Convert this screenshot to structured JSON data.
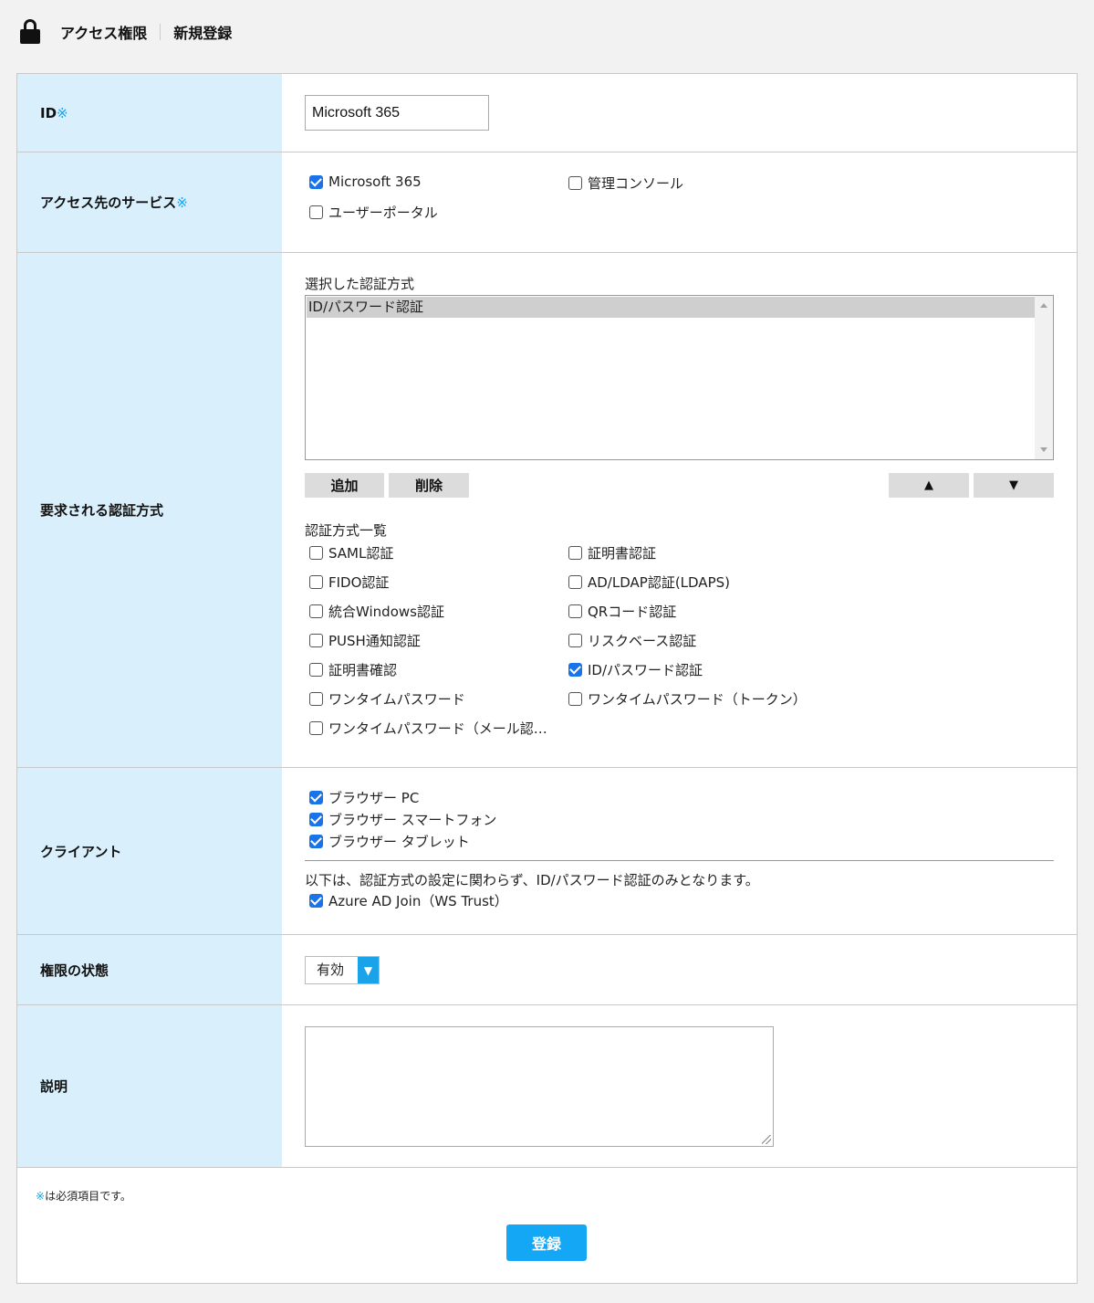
{
  "header": {
    "title": "アクセス権限",
    "subtitle": "新規登録"
  },
  "required_mark": "※",
  "id_field": {
    "label": "ID",
    "value": "Microsoft 365"
  },
  "services": {
    "label": "アクセス先のサービス",
    "options": [
      {
        "label": "Microsoft 365",
        "checked": true
      },
      {
        "label": "管理コンソール",
        "checked": false
      },
      {
        "label": "ユーザーポータル",
        "checked": false
      }
    ]
  },
  "auth": {
    "label": "要求される認証方式",
    "selected_label": "選択した認証方式",
    "selected_items": [
      "ID/パスワード認証"
    ],
    "add_label": "追加",
    "delete_label": "削除",
    "up_label": "▲",
    "down_label": "▼",
    "list_label": "認証方式一覧",
    "methods": [
      {
        "label": "SAML認証",
        "checked": false
      },
      {
        "label": "証明書認証",
        "checked": false
      },
      {
        "label": "FIDO認証",
        "checked": false
      },
      {
        "label": "AD/LDAP認証(LDAPS)",
        "checked": false
      },
      {
        "label": "統合Windows認証",
        "checked": false
      },
      {
        "label": "QRコード認証",
        "checked": false
      },
      {
        "label": "PUSH通知認証",
        "checked": false
      },
      {
        "label": "リスクベース認証",
        "checked": false
      },
      {
        "label": "証明書確認",
        "checked": false
      },
      {
        "label": "ID/パスワード認証",
        "checked": true
      },
      {
        "label": "ワンタイムパスワード",
        "checked": false
      },
      {
        "label": "ワンタイムパスワード（トークン）",
        "checked": false
      },
      {
        "label": "ワンタイムパスワード（メール認…",
        "checked": false
      }
    ]
  },
  "client": {
    "label": "クライアント",
    "options": [
      {
        "label": "ブラウザー PC",
        "checked": true
      },
      {
        "label": "ブラウザー スマートフォン",
        "checked": true
      },
      {
        "label": "ブラウザー タブレット",
        "checked": true
      }
    ],
    "note": "以下は、認証方式の設定に関わらず、ID/パスワード認証のみとなります。",
    "extra": {
      "label": "Azure AD Join（WS Trust）",
      "checked": true
    }
  },
  "status": {
    "label": "権限の状態",
    "value": "有効"
  },
  "description": {
    "label": "説明",
    "value": ""
  },
  "footer": {
    "required_note": "は必須項目です。",
    "submit_label": "登録"
  },
  "colors": {
    "label_bg": "#d9f0fc",
    "accent": "#1aa3e8",
    "submit": "#14a7f5",
    "checkbox": "#1a73e8"
  },
  "icons": {
    "header": "lock-icon"
  }
}
